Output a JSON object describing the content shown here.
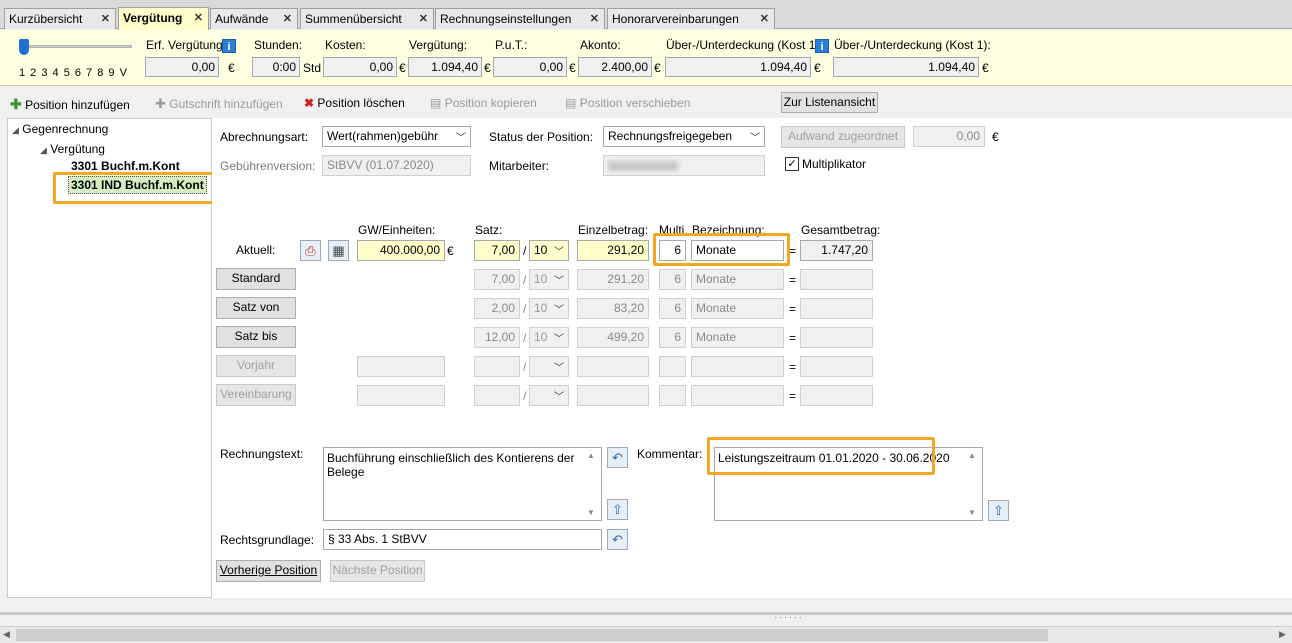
{
  "tabs": [
    {
      "label": "Kurzübersicht"
    },
    {
      "label": "Vergütung"
    },
    {
      "label": "Aufwände"
    },
    {
      "label": "Summenübersicht"
    },
    {
      "label": "Rechnungseinstellungen"
    },
    {
      "label": "Honorarvereinbarungen"
    }
  ],
  "summary": {
    "slider_ticks": "1 2 3 4 5 6 7 8 9 V",
    "slider_level": 1,
    "erf_verguetung_label": "Erf. Vergütung:",
    "erf_verguetung_value": "0,00",
    "stunden_label": "Stunden:",
    "stunden_value": "0:00",
    "stunden_unit": "Std",
    "kosten_label": "Kosten:",
    "kosten_value": "0,00",
    "verguetung_label": "Vergütung:",
    "verguetung_value": "1.094,40",
    "put_label": "P.u.T.:",
    "put_value": "0,00",
    "akonto_label": "Akonto:",
    "akonto_value": "2.400,00",
    "ueber1_label": "Über-/Unterdeckung (Kost 1)",
    "ueber1_value": "1.094,40",
    "ueber2_label": "Über-/Unterdeckung (Kost 1):",
    "ueber2_value": "1.094,40",
    "currency": "€"
  },
  "toolbar": {
    "add_position": "Position hinzufügen",
    "add_credit": "Gutschrift hinzufügen",
    "delete_position": "Position löschen",
    "copy_position": "Position kopieren",
    "move_position": "Position verschieben",
    "list_view": "Zur Listenansicht"
  },
  "tree": {
    "root": "Gegenrechnung",
    "group": "Vergütung",
    "items": [
      "3301 Buchf.m.Kont",
      "3301 IND Buchf.m.Kont"
    ]
  },
  "form": {
    "abrechnungsart_label": "Abrechnungsart:",
    "abrechnungsart_value": "Wert(rahmen)gebühr",
    "status_label": "Status der Position:",
    "status_value": "Rechnungsfreigegeben",
    "aufwand_button": "Aufwand zugeordnet",
    "aufwand_value": "0,00",
    "gebuehrenversion_label": "Gebührenversion:",
    "gebuehrenversion_value": "StBVV (01.07.2020)",
    "mitarbeiter_label": "Mitarbeiter:",
    "multiplikator_label": "Multiplikator",
    "multiplikator_checked": true
  },
  "grid": {
    "headers": {
      "gw": "GW/Einheiten:",
      "satz": "Satz:",
      "einzel": "Einzelbetrag:",
      "multi": "Multi.",
      "bez": "Bezeichnung:",
      "gesamt": "Gesamtbetrag:"
    },
    "aktuell_label": "Aktuell:",
    "aktuell": {
      "gw": "400.000,00",
      "satz": "7,00",
      "div": "10",
      "einzel": "291,20",
      "multi": "6",
      "bez": "Monate",
      "gesamt": "1.747,20"
    },
    "rows": [
      {
        "label": "Standard",
        "satz": "7,00",
        "div": "10",
        "einzel": "291,20",
        "multi": "6",
        "bez": "Monate",
        "gesamt": ""
      },
      {
        "label": "Satz von",
        "satz": "2,00",
        "div": "10",
        "einzel": "83,20",
        "multi": "6",
        "bez": "Monate",
        "gesamt": ""
      },
      {
        "label": "Satz bis",
        "satz": "12,00",
        "div": "10",
        "einzel": "499,20",
        "multi": "6",
        "bez": "Monate",
        "gesamt": ""
      },
      {
        "label": "Vorjahr",
        "satz": "",
        "div": "",
        "einzel": "",
        "multi": "",
        "bez": "",
        "gesamt": ""
      },
      {
        "label": "Vereinbarung",
        "satz": "",
        "div": "",
        "einzel": "",
        "multi": "",
        "bez": "",
        "gesamt": ""
      }
    ],
    "slash": "/",
    "equals": "=",
    "euro": "€"
  },
  "texts": {
    "rechnungstext_label": "Rechnungstext:",
    "rechnungstext_value": "Buchführung einschließlich des Kontierens der Belege",
    "kommentar_label": "Kommentar:",
    "kommentar_value": "Leistungszeitraum 01.01.2020 - 30.06.2020",
    "rechtsgrundlage_label": "Rechtsgrundlage:",
    "rechtsgrundlage_value": "§ 33 Abs. 1 StBVV",
    "prev_button": "Vorherige Position",
    "next_button": "Nächste Position"
  },
  "colors": {
    "highlight": "#f5a623",
    "yellow_field": "#ffffcc",
    "summary_bg": "#ffffe1"
  }
}
